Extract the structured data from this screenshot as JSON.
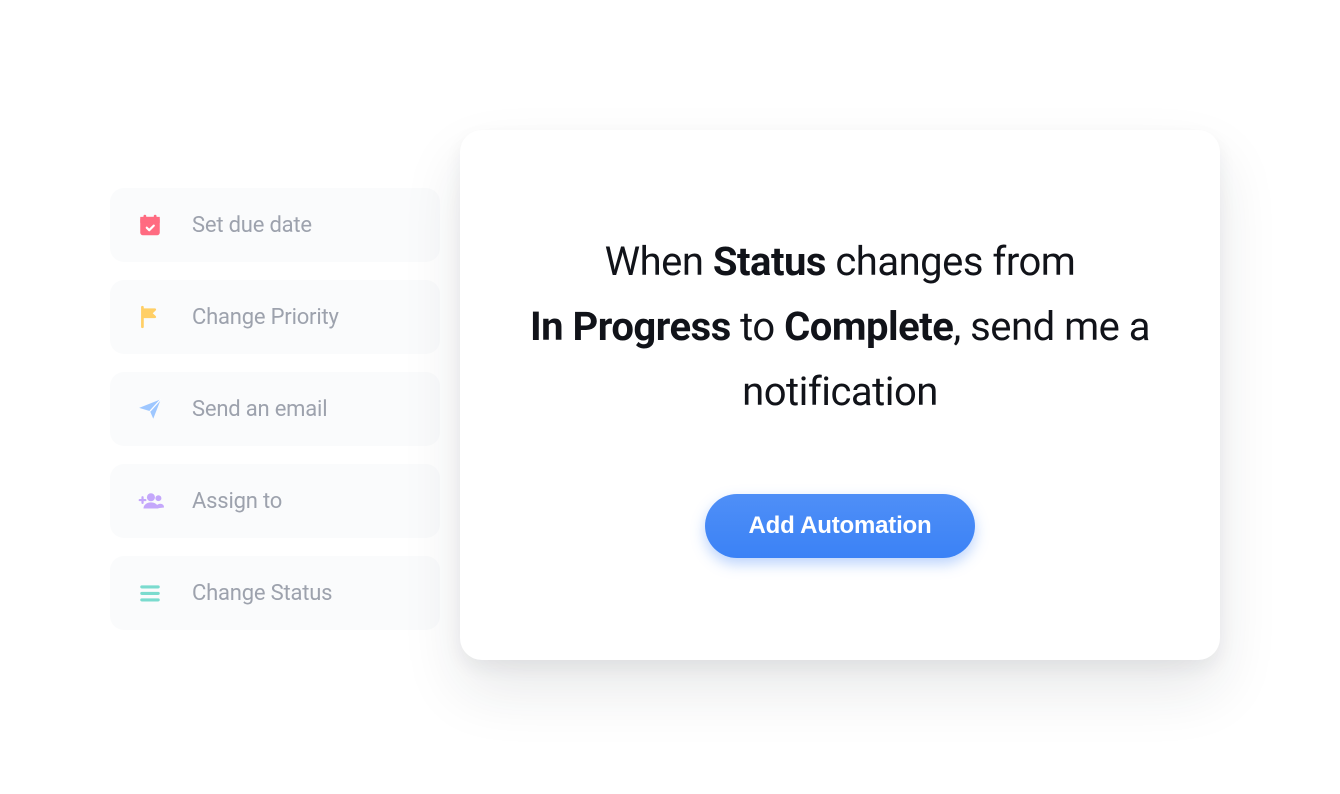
{
  "actions": [
    {
      "label": "Set due date",
      "icon": "calendar-check-icon",
      "color": "#ff6b81"
    },
    {
      "label": "Change Priority",
      "icon": "flag-icon",
      "color": "#ffcf66"
    },
    {
      "label": "Send an email",
      "icon": "paper-plane-icon",
      "color": "#9ec7ff"
    },
    {
      "label": "Assign to",
      "icon": "user-plus-icon",
      "color": "#c4a7fb"
    },
    {
      "label": "Change Status",
      "icon": "list-icon",
      "color": "#7adbce"
    }
  ],
  "automation": {
    "prefix_1": "When ",
    "bold_1": "Status",
    "mid_1": " changes from",
    "bold_2": "In Progress",
    "mid_2": " to ",
    "bold_3": "Complete",
    "suffix_1": ", send me a notification",
    "button": "Add Automation"
  },
  "colors": {
    "accent": "#3b82f6"
  }
}
